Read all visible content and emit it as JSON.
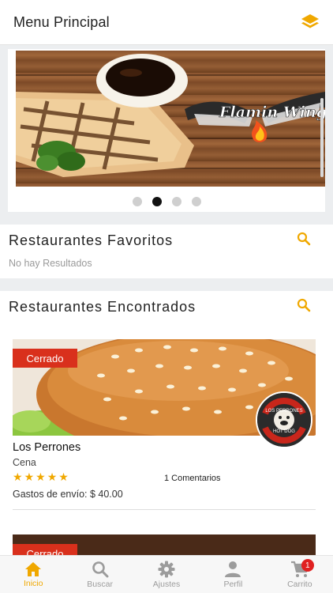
{
  "header": {
    "title": "Menu Principal"
  },
  "carousel": {
    "brand_text": "Flamin Wings",
    "dots": [
      {
        "active": false
      },
      {
        "active": true
      },
      {
        "active": false
      },
      {
        "active": false
      }
    ]
  },
  "favorites": {
    "title": "Restaurantes Favoritos",
    "empty_text": "No hay Resultados"
  },
  "found": {
    "title": "Restaurantes Encontrados",
    "restaurants": [
      {
        "status": "Cerrado",
        "logo_text_top": "LOS PERRONES",
        "logo_text_bottom": "HOT DOG",
        "name": "Los Perrones",
        "category": "Cena",
        "rating": 5,
        "comments": "1 Comentarios",
        "shipping": "Gastos de envío: $ 40.00"
      },
      {
        "status": "Cerrado"
      }
    ]
  },
  "bottom_nav": {
    "items": [
      {
        "label": "Inicio",
        "icon": "home-icon",
        "active": true
      },
      {
        "label": "Buscar",
        "icon": "search-icon",
        "active": false
      },
      {
        "label": "Ajustes",
        "icon": "gear-icon",
        "active": false
      },
      {
        "label": "Perfil",
        "icon": "person-icon",
        "active": false
      },
      {
        "label": "Carrito",
        "icon": "cart-icon",
        "active": false,
        "badge": "1"
      }
    ]
  },
  "colors": {
    "accent": "#f0a800",
    "status_closed": "#d9301c",
    "cart_badge": "#e02020"
  }
}
